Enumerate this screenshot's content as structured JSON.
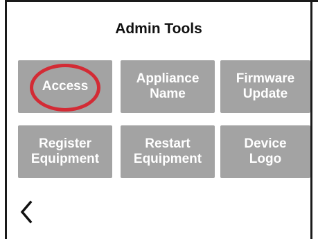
{
  "screen": {
    "title": "Admin Tools"
  },
  "tiles": [
    {
      "line1": "Access",
      "line2": ""
    },
    {
      "line1": "Appliance",
      "line2": "Name"
    },
    {
      "line1": "Firmware",
      "line2": "Update"
    },
    {
      "line1": "Register",
      "line2": "Equipment"
    },
    {
      "line1": "Restart",
      "line2": "Equipment"
    },
    {
      "line1": "Device",
      "line2": "Logo"
    }
  ],
  "annotation": {
    "highlight_color": "#d32b35",
    "highlighted_tile": "Access"
  },
  "navigation": {
    "back_icon": "chevron-left-icon"
  },
  "colors": {
    "tile_background": "#a3a3a3",
    "tile_text": "#ffffff",
    "title_text": "#111111"
  }
}
